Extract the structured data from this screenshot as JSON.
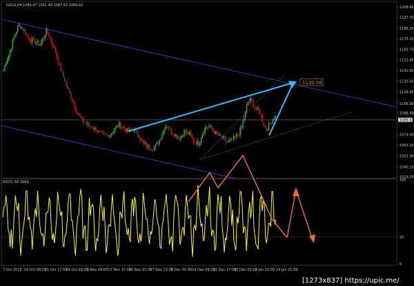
{
  "header": {
    "symbol_text": "GOLD,H4",
    "ohlc_text": "1089.47 1091.49 1087.53 1089.63",
    "rsi_text": "RSI(5) 56.3964"
  },
  "colors": {
    "background": "#000000",
    "bull": "#33cc33",
    "bear": "#cc2222",
    "channel": "#3a4ad0",
    "arrow": "#33bbff",
    "orange": "#e07030",
    "rsi_line": "#ffff00",
    "dotted": "#9a3aa0",
    "axis_text": "#c8c8c8",
    "price_line": "#8a8a8a"
  },
  "overlay": {
    "target_label": "1130.06",
    "watermark": "[1273x837] https://upic.me/"
  },
  "chart_data": [
    {
      "type": "candlestick",
      "title": "GOLD,H4",
      "current_price": 1089.63,
      "target_price": 1130.06,
      "price_labels": [
        "1208.80",
        "1197.70",
        "1186.20",
        "1175.20",
        "1163.70",
        "1152.80",
        "1141.60",
        "1130.50",
        "1118.95",
        "1106.90",
        "1096.90",
        "1089.63",
        "1074.40",
        "1063.10",
        "1051.90",
        "1040.10",
        "1029.70"
      ],
      "x_tick_labels": [
        "7 Oct 2015",
        "14 Oct 09:00",
        "21 Oct 17:00",
        "29 Oct 09:00",
        "5 Nov 09:00",
        "12 Nov 17:00",
        "20 Nov 01:00",
        "27 Nov 13:00",
        "7 Dec 01:00",
        "14 Dec 09:00",
        "21 Dec 17:00",
        "30 Dec 05:00",
        "7 Jan 13:00",
        "14 Jan 21:00"
      ],
      "close_path": [
        1143,
        1152,
        1160,
        1172,
        1182,
        1189,
        1187,
        1182,
        1176,
        1174,
        1173,
        1171,
        1169,
        1175,
        1184,
        1178,
        1170,
        1162,
        1150,
        1140,
        1132,
        1123,
        1115,
        1107,
        1098,
        1092,
        1089,
        1086,
        1083,
        1082,
        1080,
        1077,
        1075,
        1074,
        1073,
        1075,
        1078,
        1082,
        1085,
        1082,
        1079,
        1078,
        1080,
        1079,
        1075,
        1068,
        1064,
        1062,
        1061,
        1060,
        1063,
        1068,
        1075,
        1084,
        1083,
        1076,
        1075,
        1072,
        1070,
        1078,
        1076,
        1074,
        1068,
        1066,
        1065,
        1075,
        1081,
        1083,
        1081,
        1077,
        1074,
        1072,
        1070,
        1066,
        1067,
        1069,
        1072,
        1075,
        1083,
        1095,
        1108,
        1111,
        1104,
        1100,
        1097,
        1086,
        1080,
        1084,
        1090,
        1094
      ]
    },
    {
      "type": "line",
      "title": "RSI(5) 56.3964",
      "ylim": [
        0,
        100
      ],
      "tick_labels": [
        "100",
        "32",
        "0"
      ],
      "guide_level": 32,
      "forecast": [
        55,
        88,
        20
      ]
    }
  ]
}
